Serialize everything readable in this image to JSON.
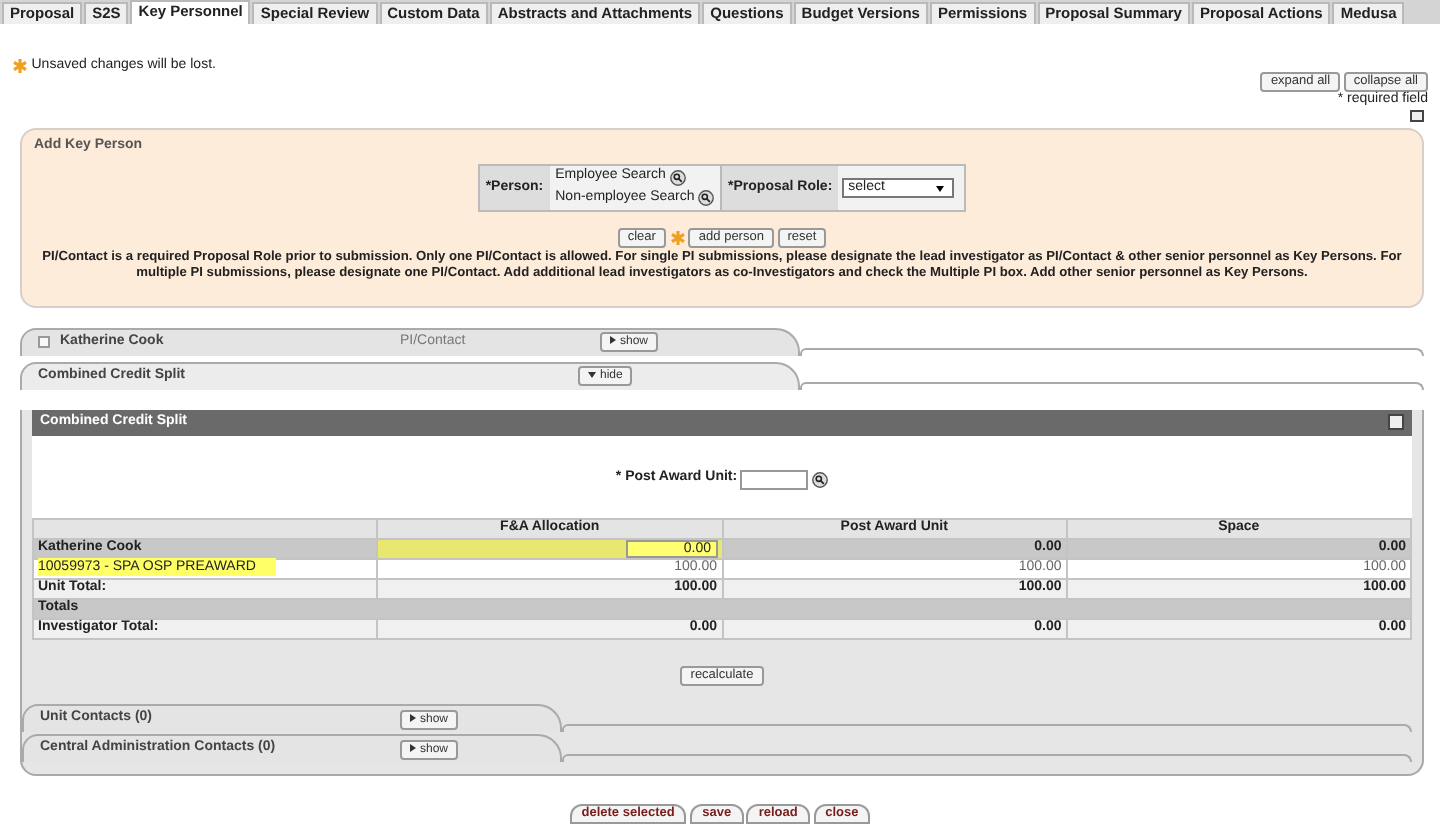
{
  "tabs": [
    {
      "label": "Proposal",
      "selected": false
    },
    {
      "label": "S2S",
      "selected": false
    },
    {
      "label": "Key Personnel",
      "selected": true
    },
    {
      "label": "Special Review",
      "selected": false
    },
    {
      "label": "Custom Data",
      "selected": false
    },
    {
      "label": "Abstracts and Attachments",
      "selected": false
    },
    {
      "label": "Questions",
      "selected": false
    },
    {
      "label": "Budget Versions",
      "selected": false
    },
    {
      "label": "Permissions",
      "selected": false
    },
    {
      "label": "Proposal Summary",
      "selected": false
    },
    {
      "label": "Proposal Actions",
      "selected": false
    },
    {
      "label": "Medusa",
      "selected": false
    }
  ],
  "notice": "Unsaved changes will be lost.",
  "top_buttons": [
    "expand all",
    "collapse all"
  ],
  "required_note": "* required field",
  "add_key_person": {
    "title": "Add Key Person",
    "person_label": "*Person:",
    "person_links": [
      "Employee Search",
      "Non-employee Search"
    ],
    "role_label": "*Proposal Role:",
    "role_value": "select",
    "buttons": [
      "clear",
      "add person",
      "reset"
    ],
    "message": "PI/Contact is a required Proposal Role prior to submission. Only one PI/Contact is allowed. For single PI submissions, please designate the lead investigator as PI/Contact & other senior personnel as Key Persons. For multiple PI submissions, please designate one PI/Contact. Add additional lead investigators as co-Investigators and check the Multiple PI box. Add other senior personnel as Key Persons."
  },
  "personnel": [
    {
      "name": "Katherine Cook",
      "role": "PI/Contact",
      "checked": false,
      "toggle": "show",
      "expanded": false
    }
  ],
  "credit_split": {
    "title": "Combined Credit Split",
    "toggle": "hide",
    "expanded": true,
    "panel_title": "Combined Credit Split",
    "post_award_label": "* Post Award Unit:",
    "columns": [
      "F&A Allocation",
      "Post Award Unit",
      "Space"
    ],
    "rows": [
      {
        "kind": "investigator",
        "label": "Katherine Cook",
        "highlighted": false,
        "cells": [
          {
            "value": "0.00",
            "editable": true,
            "highlighted": true
          },
          {
            "value": "0.00",
            "editable": false,
            "highlighted": false
          },
          {
            "value": "0.00",
            "editable": false,
            "highlighted": false
          }
        ]
      },
      {
        "kind": "unit",
        "label": "10059973 - SPA OSP PREAWARD",
        "highlighted": true,
        "cells": [
          {
            "value": "100.00",
            "editable": false,
            "highlighted": false
          },
          {
            "value": "100.00",
            "editable": false,
            "highlighted": false
          },
          {
            "value": "100.00",
            "editable": false,
            "highlighted": false
          }
        ]
      },
      {
        "kind": "total",
        "label": "Unit Total:",
        "highlighted": false,
        "cells": [
          {
            "value": "100.00",
            "editable": false,
            "highlighted": false
          },
          {
            "value": "100.00",
            "editable": false,
            "highlighted": false
          },
          {
            "value": "100.00",
            "editable": false,
            "highlighted": false
          }
        ]
      },
      {
        "kind": "heading",
        "label": "Totals",
        "highlighted": false,
        "cells": []
      },
      {
        "kind": "total",
        "label": "Investigator Total:",
        "highlighted": false,
        "cells": [
          {
            "value": "0.00",
            "editable": false,
            "highlighted": false
          },
          {
            "value": "0.00",
            "editable": false,
            "highlighted": false
          },
          {
            "value": "0.00",
            "editable": false,
            "highlighted": false
          }
        ]
      }
    ],
    "recalculate": "recalculate"
  },
  "subsections": [
    {
      "title": "Unit Contacts (0)",
      "toggle": "show",
      "expanded": false
    },
    {
      "title": "Central Administration Contacts (0)",
      "toggle": "show",
      "expanded": false
    }
  ],
  "bottom_buttons": [
    "delete selected",
    "save",
    "reload",
    "close"
  ]
}
